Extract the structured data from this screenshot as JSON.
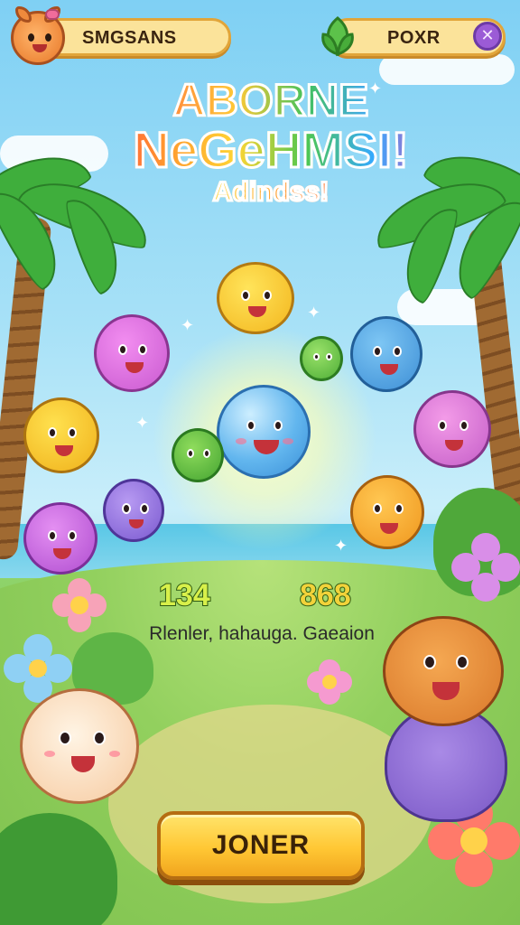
{
  "header": {
    "player_name": "SMGSANS",
    "resource_label": "POXR",
    "close_symbol": "✕"
  },
  "title": {
    "line1": "ABORNE",
    "line2": "NeGeHMSI!",
    "line3": "Adindss!"
  },
  "scores": {
    "left": "134",
    "right": "868"
  },
  "subtitle": "Rlenler, hahauga. Gaeaion",
  "play_button": {
    "label": "JONER"
  },
  "icons": {
    "player_avatar": "cat-face-icon",
    "resource": "leaf-icon",
    "close": "close-icon"
  },
  "colors": {
    "pill_bg": "#fbe39a",
    "pill_border": "#e1a53a",
    "button": "#ffc734",
    "sky": "#7fd0f4",
    "grass": "#8fd36a"
  }
}
